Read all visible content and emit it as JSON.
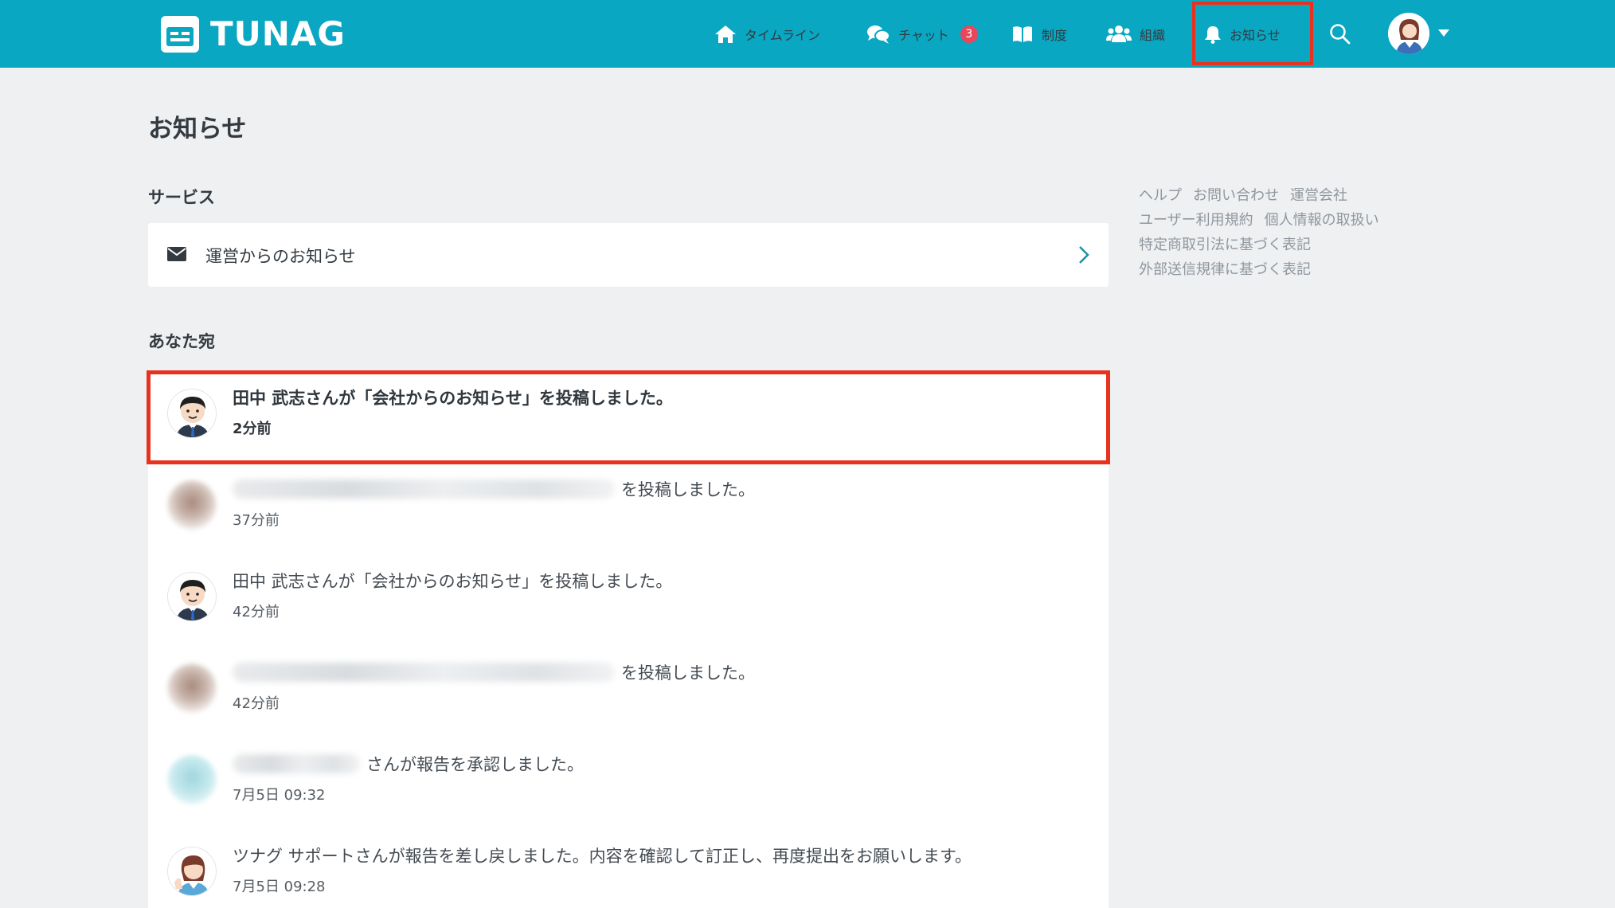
{
  "header": {
    "brand": "TUNAG",
    "nav": [
      {
        "label": "タイムライン",
        "icon": "home-icon"
      },
      {
        "label": "チャット",
        "icon": "chat-icon",
        "badge": "3"
      },
      {
        "label": "制度",
        "icon": "book-icon"
      },
      {
        "label": "組織",
        "icon": "users-icon"
      },
      {
        "label": "お知らせ",
        "icon": "bell-icon",
        "active": true
      }
    ]
  },
  "page": {
    "title": "お知らせ",
    "service_section": "サービス",
    "service_item": "運営からのお知らせ",
    "you_section": "あなた宛"
  },
  "notifications": [
    {
      "text": "田中 武志さんが「会社からのお知らせ」を投稿しました。",
      "time": "2分前",
      "unread": true,
      "avatar": "businessman"
    },
    {
      "text": "を投稿しました。",
      "time": "37分前",
      "unread": false,
      "avatar": "blurred-person"
    },
    {
      "text": "田中 武志さんが「会社からのお知らせ」を投稿しました。",
      "time": "42分前",
      "unread": false,
      "avatar": "businessman"
    },
    {
      "text": "を投稿しました。",
      "time": "42分前",
      "unread": false,
      "avatar": "blurred-person"
    },
    {
      "text": "さんが報告を承認しました。",
      "time": "7月5日 09:32",
      "unread": false,
      "avatar": "blurred-teal"
    },
    {
      "text": "ツナグ サポートさんが報告を差し戻しました。内容を確認して訂正し、再度提出をお願いします。",
      "time": "7月5日 09:28",
      "unread": false,
      "avatar": "support-woman"
    }
  ],
  "sidebar_links": [
    [
      "ヘルプ",
      "お問い合わせ",
      "運営会社"
    ],
    [
      "ユーザー利用規約",
      "個人情報の取扱い"
    ],
    [
      "特定商取引法に基づく表記"
    ],
    [
      "外部送信規律に基づく表記"
    ]
  ],
  "colors": {
    "header": "#09a7c2",
    "highlight": "#e8321f",
    "badge": "#e8475b"
  }
}
